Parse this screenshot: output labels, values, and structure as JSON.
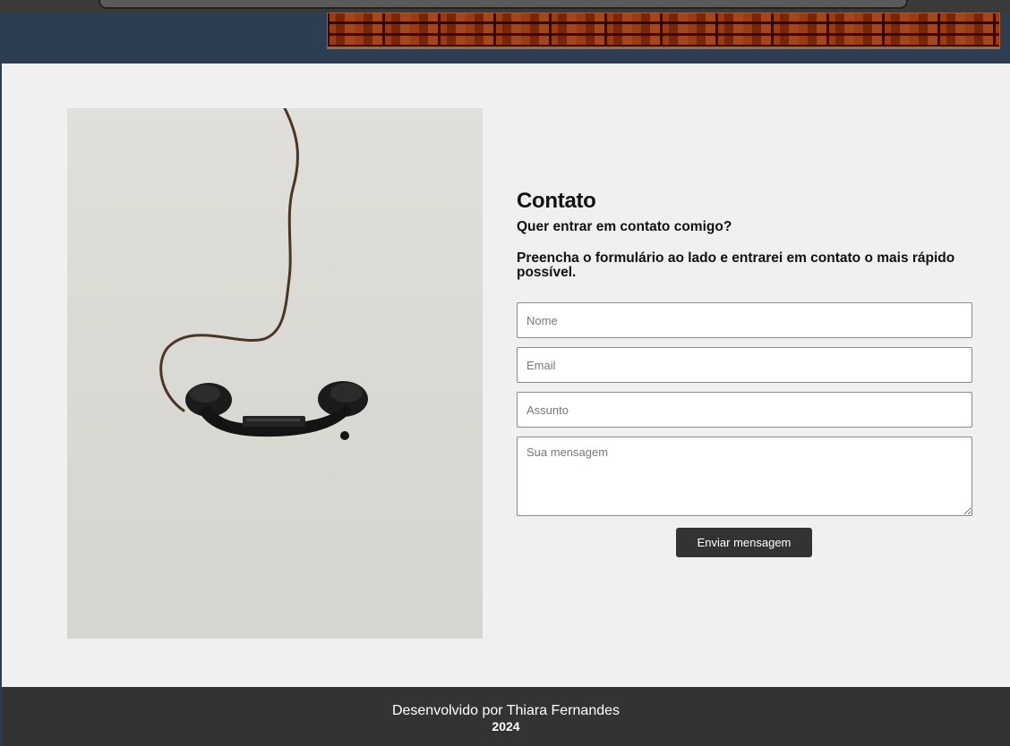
{
  "contact": {
    "title": "Contato",
    "question": "Quer entrar em contato comigo?",
    "instructions": "Preencha o formulário ao lado e entrarei em contato o mais rápido possível."
  },
  "form": {
    "name_placeholder": "Nome",
    "email_placeholder": "Email",
    "subject_placeholder": "Assunto",
    "message_placeholder": "Sua mensagem",
    "submit_label": "Enviar mensagem"
  },
  "footer": {
    "credit": "Desenvolvido por Thiara Fernandes",
    "year": "2024"
  },
  "colors": {
    "header_bg": "#2c3e50",
    "main_bg": "#f0f0f0",
    "footer_bg": "#333333",
    "button_bg": "#333333",
    "brick": "#8a2e0e"
  },
  "icons": {
    "banner": "brick-wall-banner",
    "photo": "telephone-handset-photo"
  }
}
